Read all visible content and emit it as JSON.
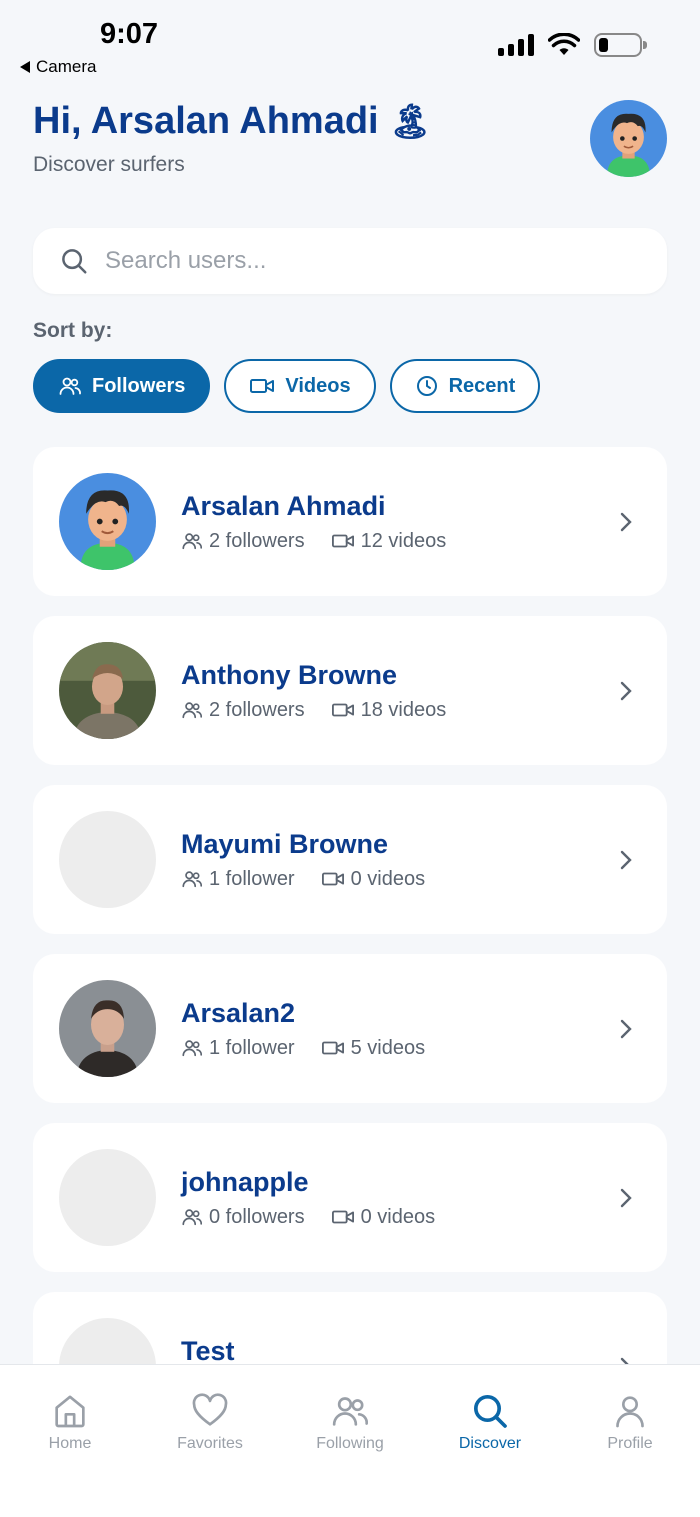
{
  "status_bar": {
    "time": "9:07",
    "back_label": "Camera"
  },
  "header": {
    "greeting": "Hi, Arsalan Ahmadi",
    "greeting_emoji": "🏝",
    "subtitle": "Discover surfers"
  },
  "search": {
    "placeholder": "Search users..."
  },
  "sort": {
    "label": "Sort by:",
    "options": [
      {
        "label": "Followers",
        "icon": "users-icon",
        "active": true
      },
      {
        "label": "Videos",
        "icon": "video-icon",
        "active": false
      },
      {
        "label": "Recent",
        "icon": "clock-icon",
        "active": false
      }
    ]
  },
  "users": [
    {
      "name": "Arsalan Ahmadi",
      "followers": "2 followers",
      "videos": "12 videos",
      "avatar": "cartoon"
    },
    {
      "name": "Anthony Browne",
      "followers": "2 followers",
      "videos": "18 videos",
      "avatar": "photo-man-outdoor"
    },
    {
      "name": "Mayumi Browne",
      "followers": "1 follower",
      "videos": "0 videos",
      "avatar": "placeholder"
    },
    {
      "name": "Arsalan2",
      "followers": "1 follower",
      "videos": "5 videos",
      "avatar": "photo-man-portrait"
    },
    {
      "name": "johnapple",
      "followers": "0 followers",
      "videos": "0 videos",
      "avatar": "placeholder"
    },
    {
      "name": "Test",
      "followers": "",
      "videos": "",
      "avatar": "placeholder"
    }
  ],
  "nav": [
    {
      "label": "Home",
      "icon": "home-icon",
      "active": false
    },
    {
      "label": "Favorites",
      "icon": "heart-icon",
      "active": false
    },
    {
      "label": "Following",
      "icon": "users-icon",
      "active": false
    },
    {
      "label": "Discover",
      "icon": "search-icon",
      "active": true
    },
    {
      "label": "Profile",
      "icon": "profile-icon",
      "active": false
    }
  ],
  "colors": {
    "primary": "#0b67a8",
    "title": "#0b3b8c",
    "background": "#f5f7fa"
  }
}
